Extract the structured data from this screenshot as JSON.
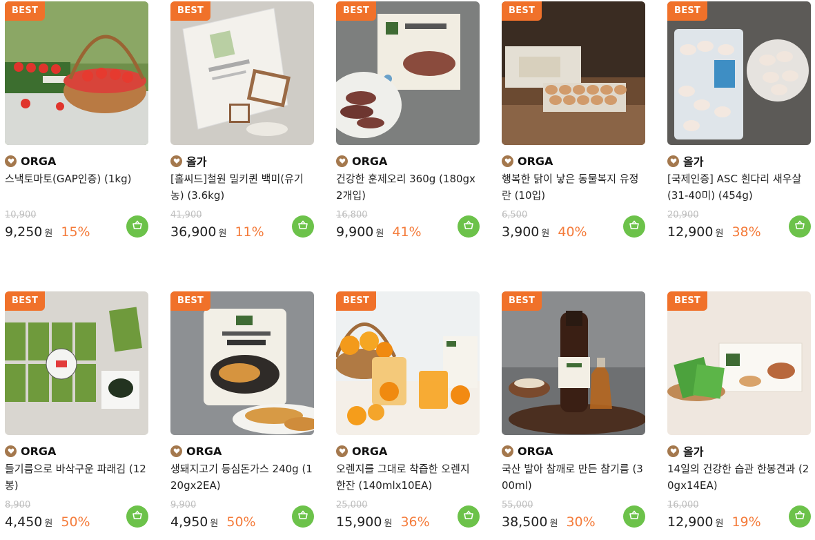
{
  "colors": {
    "badge": "#f0712a",
    "discount": "#f47b3a",
    "cart": "#6cc24a",
    "brand_icon": "#a4784d"
  },
  "badge_label": "BEST",
  "products": [
    {
      "brand": "ORGA",
      "name": "스낵토마토(GAP인증) (1kg)",
      "original_price": "10,900",
      "price": "9,250",
      "unit": "원",
      "discount": "15%",
      "image": "tomato-basket"
    },
    {
      "brand": "올가",
      "name": "[홀씨드]철원 밀키퀸 백미(유기농) (3.6kg)",
      "original_price": "41,900",
      "price": "36,900",
      "unit": "원",
      "discount": "11%",
      "image": "rice-bag"
    },
    {
      "brand": "ORGA",
      "name": "건강한 훈제오리 360g (180gx2개입)",
      "original_price": "16,800",
      "price": "9,900",
      "unit": "원",
      "discount": "41%",
      "image": "smoked-duck"
    },
    {
      "brand": "ORGA",
      "name": "행복한 닭이 낳은 동물복지 유정란 (10입)",
      "original_price": "6,500",
      "price": "3,900",
      "unit": "원",
      "discount": "40%",
      "image": "eggs"
    },
    {
      "brand": "올가",
      "name": "[국제인증] ASC 흰다리 새우살(31-40미) (454g)",
      "original_price": "20,900",
      "price": "12,900",
      "unit": "원",
      "discount": "38%",
      "image": "shrimp"
    },
    {
      "brand": "ORGA",
      "name": "들기름으로 바삭구운 파래김 (12봉)",
      "original_price": "8,900",
      "price": "4,450",
      "unit": "원",
      "discount": "50%",
      "image": "seaweed"
    },
    {
      "brand": "ORGA",
      "name": "생돼지고기 등심돈가스 240g (120gx2EA)",
      "original_price": "9,900",
      "price": "4,950",
      "unit": "원",
      "discount": "50%",
      "image": "pork-cutlet"
    },
    {
      "brand": "ORGA",
      "name": "오렌지를 그대로 착즙한 오렌지 한잔 (140mlx10EA)",
      "original_price": "25,000",
      "price": "15,900",
      "unit": "원",
      "discount": "36%",
      "image": "orange-juice"
    },
    {
      "brand": "ORGA",
      "name": "국산 발아 참깨로 만든 참기름 (300ml)",
      "original_price": "55,000",
      "price": "38,500",
      "unit": "원",
      "discount": "30%",
      "image": "sesame-oil"
    },
    {
      "brand": "올가",
      "name": "14일의 건강한 습관 한봉견과 (20gx14EA)",
      "original_price": "16,000",
      "price": "12,900",
      "unit": "원",
      "discount": "19%",
      "image": "nuts-box"
    }
  ]
}
